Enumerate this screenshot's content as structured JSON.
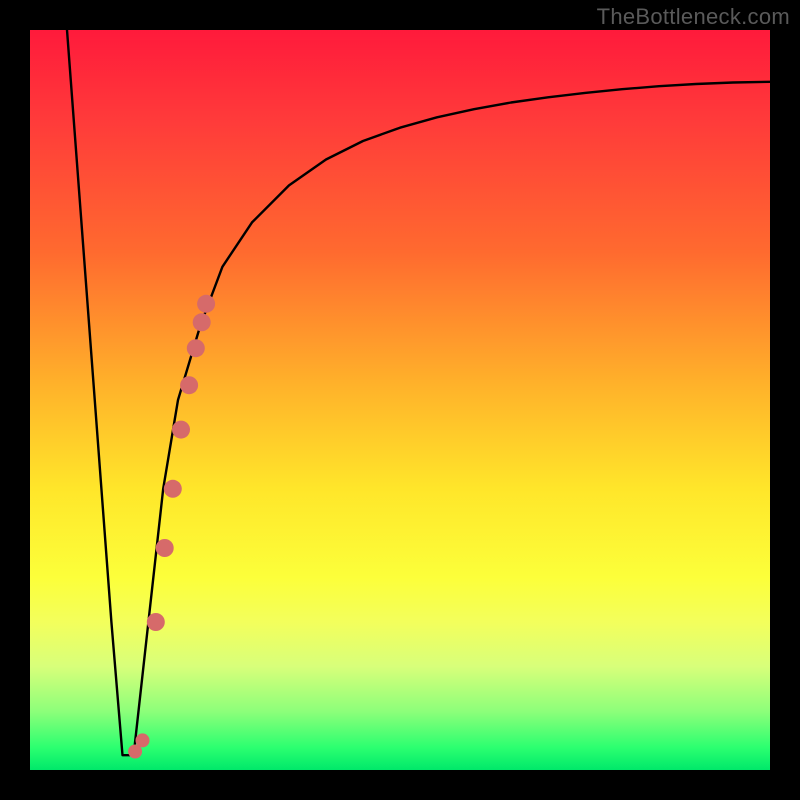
{
  "watermark": "TheBottleneck.com",
  "chart_data": {
    "type": "line",
    "title": "",
    "xlabel": "",
    "ylabel": "",
    "xlim": [
      0,
      100
    ],
    "ylim": [
      0,
      100
    ],
    "series": [
      {
        "name": "curve",
        "x": [
          5,
          8,
          11,
          12.5,
          14,
          16,
          18,
          20,
          23,
          26,
          30,
          35,
          40,
          45,
          50,
          55,
          60,
          65,
          70,
          75,
          80,
          85,
          90,
          95,
          100
        ],
        "y": [
          100,
          60,
          20,
          2,
          2,
          20,
          38,
          50,
          60,
          68,
          74,
          79,
          82.5,
          85,
          86.8,
          88.2,
          89.3,
          90.2,
          90.9,
          91.5,
          92,
          92.4,
          92.7,
          92.9,
          93
        ]
      },
      {
        "name": "highlight-dots",
        "x": [
          14.2,
          15.2,
          17.0,
          18.2,
          19.3,
          20.4,
          21.5,
          22.4,
          23.2,
          23.8
        ],
        "y": [
          2.5,
          4.0,
          20.0,
          30.0,
          38.0,
          46.0,
          52.0,
          57.0,
          60.5,
          63.0
        ]
      }
    ],
    "colors": {
      "curve": "#000000",
      "dots": "#d66a6a",
      "gradient_top": "#ff1a3b",
      "gradient_bottom": "#00e86a",
      "frame": "#000000"
    }
  }
}
